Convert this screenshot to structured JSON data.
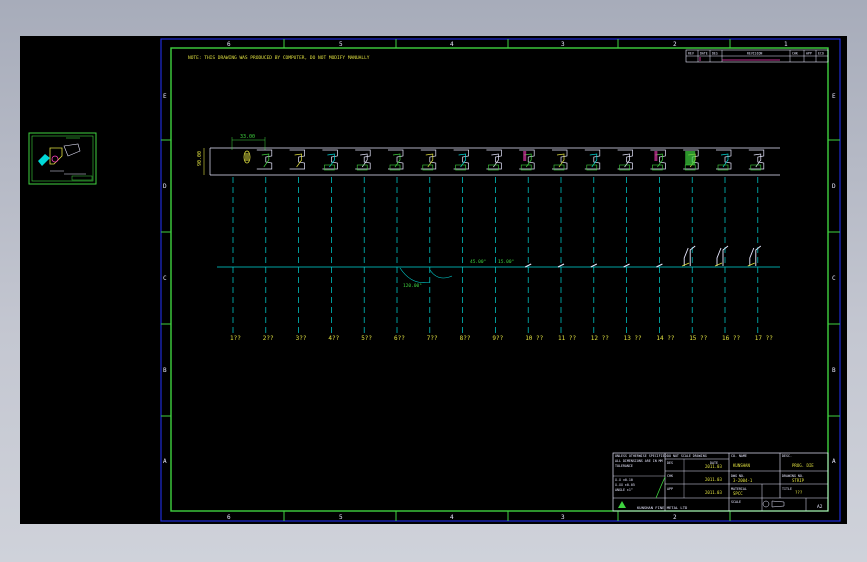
{
  "drawing": {
    "note": "NOTE: THIS DRAWING WAS PRODUCED BY COMPUTER, DO NOT MODIFY MANUALLY",
    "dim_pitch": "33.00",
    "dim_width": "90.00",
    "angle_1": "45.00°",
    "angle_2": "15.00°",
    "angle_3": "120.00°",
    "col_labels": [
      "6",
      "5",
      "4",
      "3",
      "2",
      "1"
    ],
    "row_labels": [
      "E",
      "D",
      "C",
      "B",
      "A"
    ],
    "stations": [
      "1??",
      "2??",
      "3??",
      "4??",
      "5??",
      "6??",
      "7??",
      "8??",
      "9??",
      "10 ??",
      "11 ??",
      "12 ??",
      "13 ??",
      "14 ??",
      "15 ??",
      "16 ??",
      "17 ??"
    ]
  },
  "revision_block": {
    "headers": [
      "REV",
      "DATE",
      "DES",
      "REVISION",
      "CHK",
      "APP",
      "ECO"
    ]
  },
  "title_block": {
    "general_tol": "UNLESS OTHERWISE SPECIFIED",
    "dims_in": "ALL DIMENSIONS ARE IN MM",
    "tol_label": "TOLERANCE",
    "tol_rows": [
      "X.X ±0.10",
      "X.XX ±0.05"
    ],
    "angle_tol": "ANGLE ±1°",
    "do_not_scale": "DO NOT SCALE DRAWING",
    "des_label": "DES",
    "chk_label": "CHK",
    "app_label": "APP",
    "date_label": "DATE",
    "date_val": "2011.03",
    "co_name_label": "CO. NAME",
    "co_name_val": "KUNSHAN",
    "part_no_label": "DWG NO.",
    "part_no_val": "3-2004-1",
    "material_label": "MATERIAL",
    "material_val": "SPCC",
    "desc_label": "DESC.",
    "desc_val": "PROG. DIE",
    "drawing_no_label": "DRAWING NO.",
    "drawing_no_val": "STRIP",
    "title_label": "TITLE",
    "title_val": "???",
    "company": "KUNSHAN FINE METAL LTD",
    "scale_label": "SCALE",
    "sheet_size": "A2"
  },
  "colors": {
    "frame": "#1f2bd6",
    "border": "#3fd23f",
    "line": "#00d8d8",
    "text": "#e8e8ff",
    "part": "#3fd23f",
    "accent": "#ff3fbf",
    "yellow": "#e0e040"
  }
}
